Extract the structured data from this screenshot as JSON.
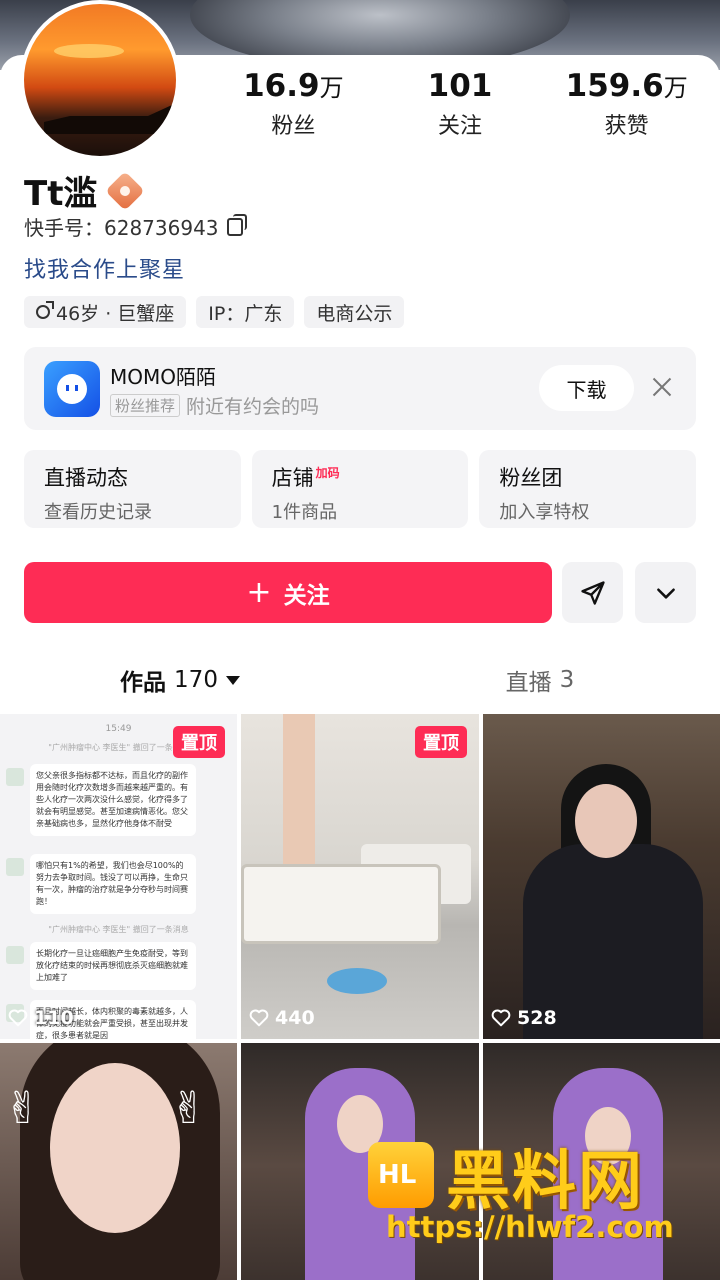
{
  "profile": {
    "name": "Tt滥",
    "kuaishou_id": "快手号：628736943",
    "bio": "找我合作上聚星",
    "tags": [
      "46岁 · 巨蟹座",
      "IP：广东",
      "电商公示"
    ]
  },
  "stats": [
    {
      "num": "16.9",
      "unit": "万",
      "label": "粉丝"
    },
    {
      "num": "101",
      "unit": "",
      "label": "关注"
    },
    {
      "num": "159.6",
      "unit": "万",
      "label": "获赞"
    }
  ],
  "ad": {
    "title": "MOMO陌陌",
    "tag": "粉丝推荐",
    "subtitle": "附近有约会的吗",
    "button": "下载"
  },
  "cards": [
    {
      "title": "直播动态",
      "badge": "",
      "sub": "查看历史记录"
    },
    {
      "title": "店铺",
      "badge": "加码",
      "sub": "1件商品"
    },
    {
      "title": "粉丝团",
      "badge": "",
      "sub": "加入享特权"
    }
  ],
  "actions": {
    "follow": "关注",
    "plus": "+"
  },
  "tabs": {
    "works_label": "作品",
    "works_count": "170",
    "live_label": "直播",
    "live_count": "3"
  },
  "grid": {
    "pin_label": "置顶",
    "items": [
      {
        "likes": "110",
        "pinned": true
      },
      {
        "likes": "440",
        "pinned": true
      },
      {
        "likes": "528",
        "pinned": false
      }
    ],
    "chat": {
      "time": "15:49",
      "sys1": "\"广州肿瘤中心  李医生\" 撤回了一条消息",
      "msg1": "您父亲很多指标都不达标，而且化疗的副作用会随时化疗次数增多而越来越严重的。有些人化疗一次两次没什么感觉，化疗得多了就会有明显感觉。甚至加速病情恶化。您父亲基础病也多，显然化疗他身体不耐受",
      "msg2": "哪怕只有1%的希望，我们也会尽100%的努力去争取时间。钱没了可以再挣，生命只有一次，肿瘤的治疗就是争分夺秒与时间赛跑！",
      "sys2": "\"广州肿瘤中心  李医生\" 撤回了一条消息",
      "msg3": "长期化疗一旦让癌细胞产生免疫耐受，等到放化疗结束的时候再想彻底杀灭癌细胞就难上加难了",
      "msg4": "而且时间越长，体内积聚的毒素就越多，人体的免疫功能就会严重受损，甚至出现并发症，很多患者就是因"
    }
  },
  "watermark": {
    "brand": "黑料网",
    "url": "https://hlwf2.com"
  },
  "colors": {
    "accent": "#fe2c55",
    "bio_link": "#2a4b8a",
    "watermark": "#ffcc1a"
  }
}
